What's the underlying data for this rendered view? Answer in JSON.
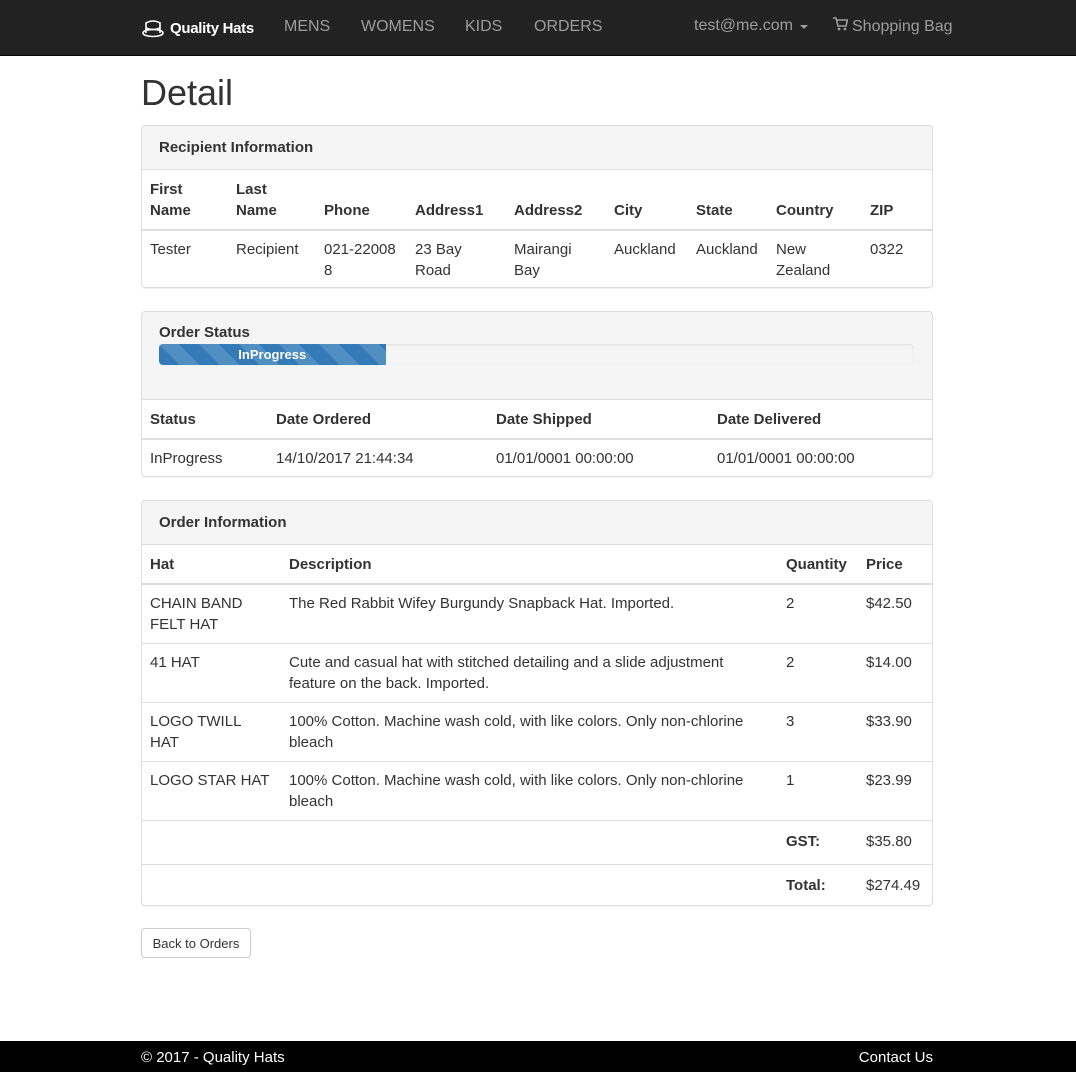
{
  "navbar": {
    "brand": "Quality Hats",
    "brand_icon": "hat-logo-icon",
    "links": [
      "MENS",
      "WOMENS",
      "KIDS",
      "ORDERS"
    ],
    "user": "test@me.com",
    "bag": "Shopping Bag",
    "bag_icon": "shopping-cart-icon"
  },
  "page": {
    "title": "Detail"
  },
  "recipient": {
    "heading": "Recipient Information",
    "columns": [
      "First Name",
      "Last Name",
      "Phone",
      "Address1",
      "Address2",
      "City",
      "State",
      "Country",
      "ZIP"
    ],
    "row": [
      "Tester",
      "Recipient",
      "021-220088",
      "23 Bay Road",
      "Mairangi Bay",
      "Auckland",
      "Auckland",
      "New Zealand",
      "0322"
    ]
  },
  "status": {
    "heading": "Order Status",
    "progress_label": "InProgress",
    "progress_fraction": 0.3,
    "columns": [
      "Status",
      "Date Ordered",
      "Date Shipped",
      "Date Delivered"
    ],
    "row": [
      "InProgress",
      "14/10/2017 21:44:34",
      "01/01/0001 00:00:00",
      "01/01/0001 00:00:00"
    ]
  },
  "order": {
    "heading": "Order Information",
    "columns": [
      "Hat",
      "Description",
      "Quantity",
      "Price"
    ],
    "rows": [
      [
        "CHAIN BAND FELT HAT",
        "The Red Rabbit Wifey Burgundy Snapback Hat. Imported.",
        "2",
        "$42.50"
      ],
      [
        "41 HAT",
        "Cute and casual hat with stitched detailing and a slide adjustment feature on the back. Imported.",
        "2",
        "$14.00"
      ],
      [
        "LOGO TWILL HAT",
        "100% Cotton. Machine wash cold, with like colors. Only non-chlorine bleach",
        "3",
        "$33.90"
      ],
      [
        "LOGO STAR HAT",
        "100% Cotton. Machine wash cold, with like colors. Only non-chlorine bleach",
        "1",
        "$23.99"
      ]
    ],
    "gst_label": "GST:",
    "gst_value": "$35.80",
    "total_label": "Total:",
    "total_value": "$274.49"
  },
  "back_button": "Back to Orders",
  "footer": {
    "copyright": "© 2017 - Quality Hats",
    "contact": "Contact Us"
  }
}
